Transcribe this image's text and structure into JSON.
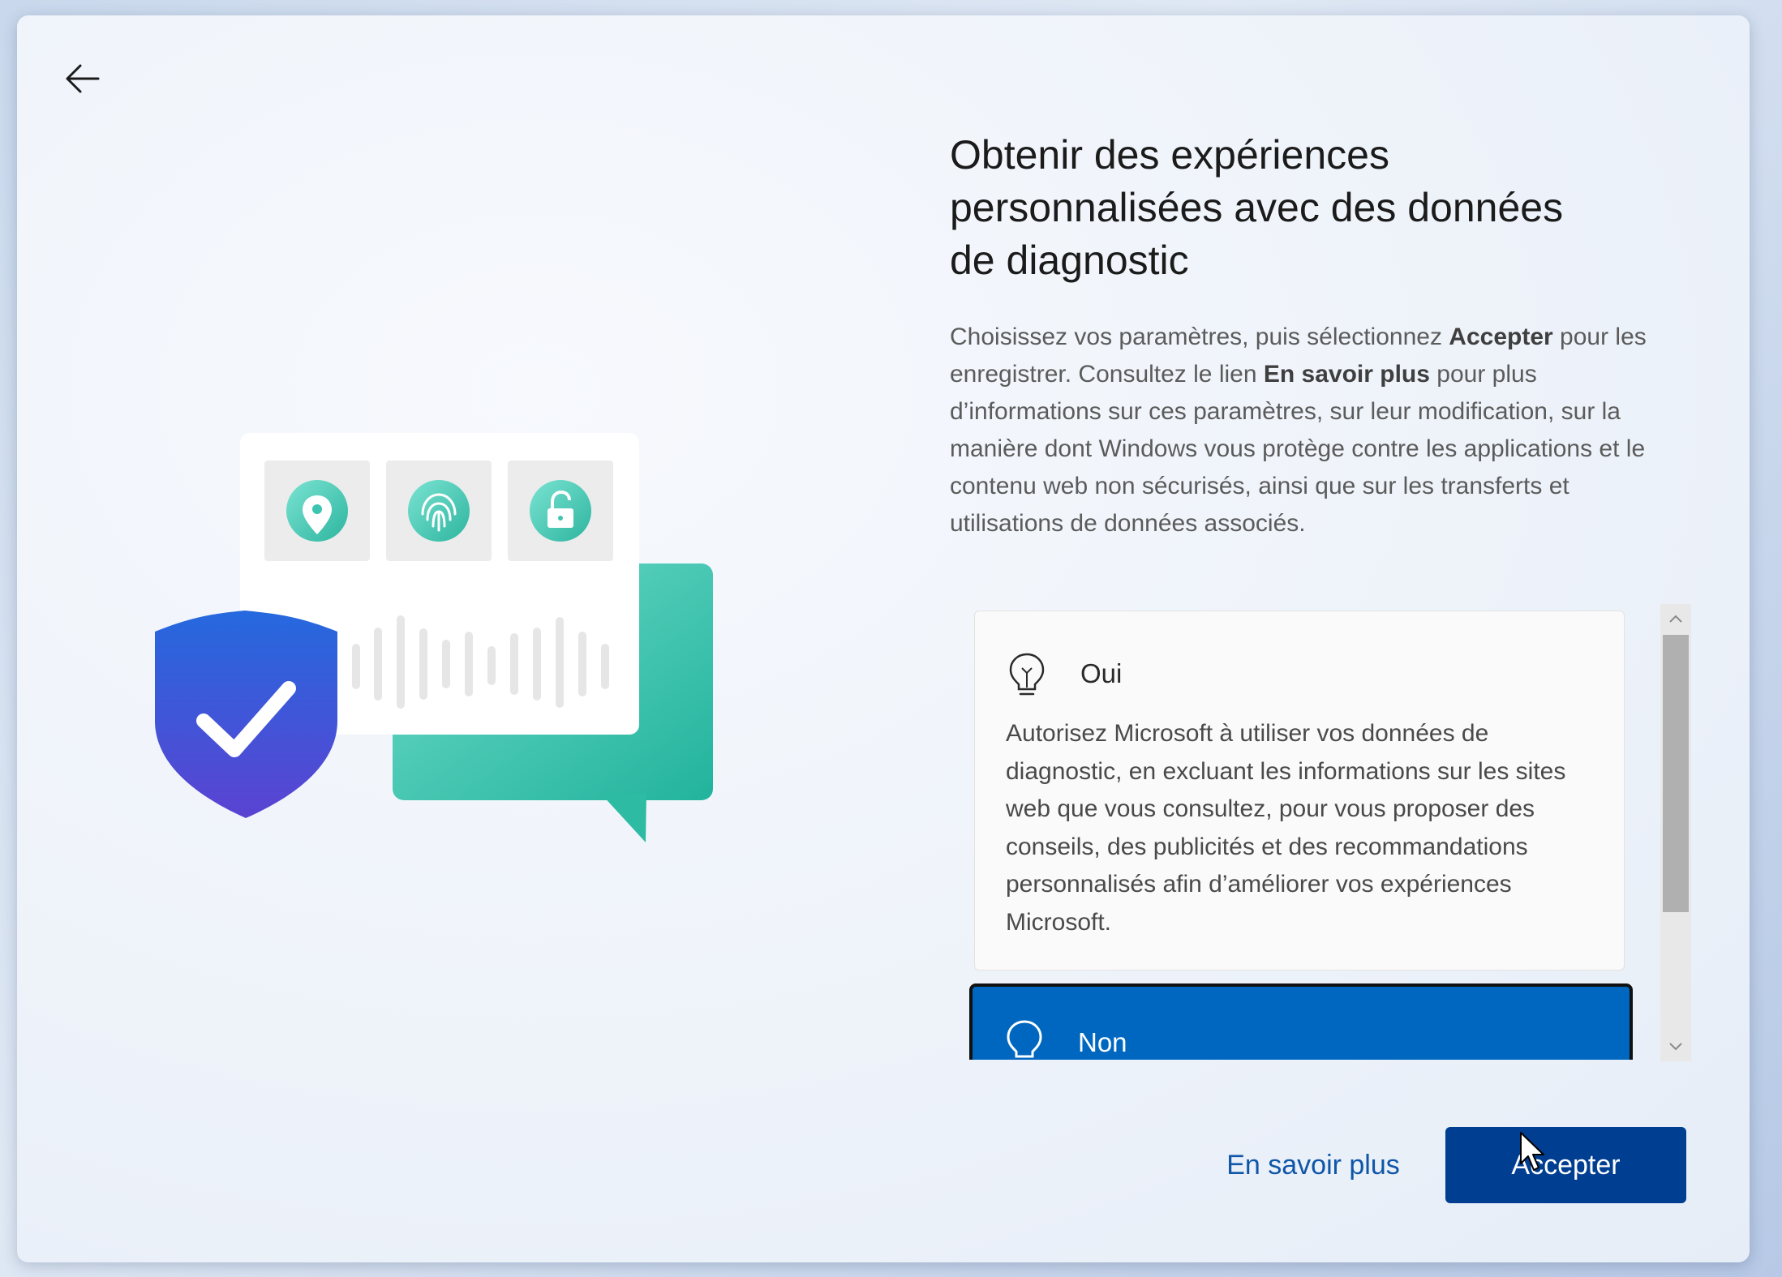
{
  "header": {
    "back_icon": "arrow-left-icon"
  },
  "main": {
    "title_line1": "Obtenir des expériences",
    "title_line2": "personnalisées avec des données",
    "title_line3": "de diagnostic",
    "description": {
      "part1": "Choisissez vos paramètres, puis sélectionnez ",
      "bold1": "Accepter",
      "part2": " pour les enregistrer. Consultez le lien ",
      "bold2": "En savoir plus",
      "part3": " pour plus d’informations sur ces paramètres, sur leur modification, sur la manière dont Windows vous protège contre les applications et le contenu web non sécurisés, ainsi que sur les transferts et utilisations de données associés."
    }
  },
  "options": [
    {
      "title": "Oui",
      "icon": "lightbulb-on-icon",
      "body": "Autorisez Microsoft à utiliser vos données de diagnostic, en excluant les informations sur les sites web que vous consultez, pour vous proposer des conseils, des publicités et des recommandations personnalisés afin d’améliorer vos expériences Microsoft.",
      "selected": false
    },
    {
      "title": "Non",
      "icon": "lightbulb-off-icon",
      "selected": true
    }
  ],
  "footer": {
    "learn_more": "En savoir plus",
    "accept": "Accepter"
  },
  "colors": {
    "accent": "#0067c0",
    "accept_button": "#003e92",
    "link": "#0f56a8",
    "teal": "#3cc5b0",
    "shield_blue": "#2a5fd6"
  }
}
